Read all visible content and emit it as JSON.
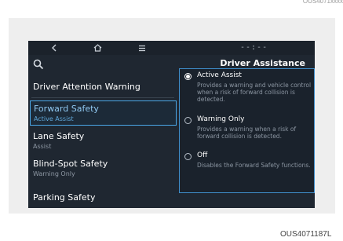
{
  "page": {
    "top_code": "OUS4071xxxx",
    "figure_code": "OUS4071187L"
  },
  "nav": {
    "icons": [
      "back-icon",
      "home-icon",
      "menu-icon"
    ],
    "clock": "--:--"
  },
  "left_menu": {
    "search_icon": "search-icon",
    "items": [
      {
        "label": "Driver Attention Warning",
        "sub": ""
      },
      {
        "label": "Forward Safety",
        "sub": "Active Assist",
        "selected": true
      },
      {
        "label": "Lane Safety",
        "sub": "Assist"
      },
      {
        "label": "Blind-Spot Safety",
        "sub": "Warning Only"
      },
      {
        "label": "Parking Safety",
        "sub": ""
      }
    ]
  },
  "right_panel": {
    "title": "Driver Assistance",
    "options": [
      {
        "title": "Active Assist",
        "desc": "Provides a warning and vehicle control when a risk of forward collision is detected.",
        "checked": true
      },
      {
        "title": "Warning Only",
        "desc": "Provides a warning when a risk of forward collision is detected.",
        "checked": false
      },
      {
        "title": "Off",
        "desc": "Disables the Forward Safety functions.",
        "checked": false
      }
    ]
  },
  "colors": {
    "screen_bg": "#1f2731",
    "accent": "#4aa7e8",
    "text": "#ffffff",
    "muted": "#8d97a3"
  }
}
